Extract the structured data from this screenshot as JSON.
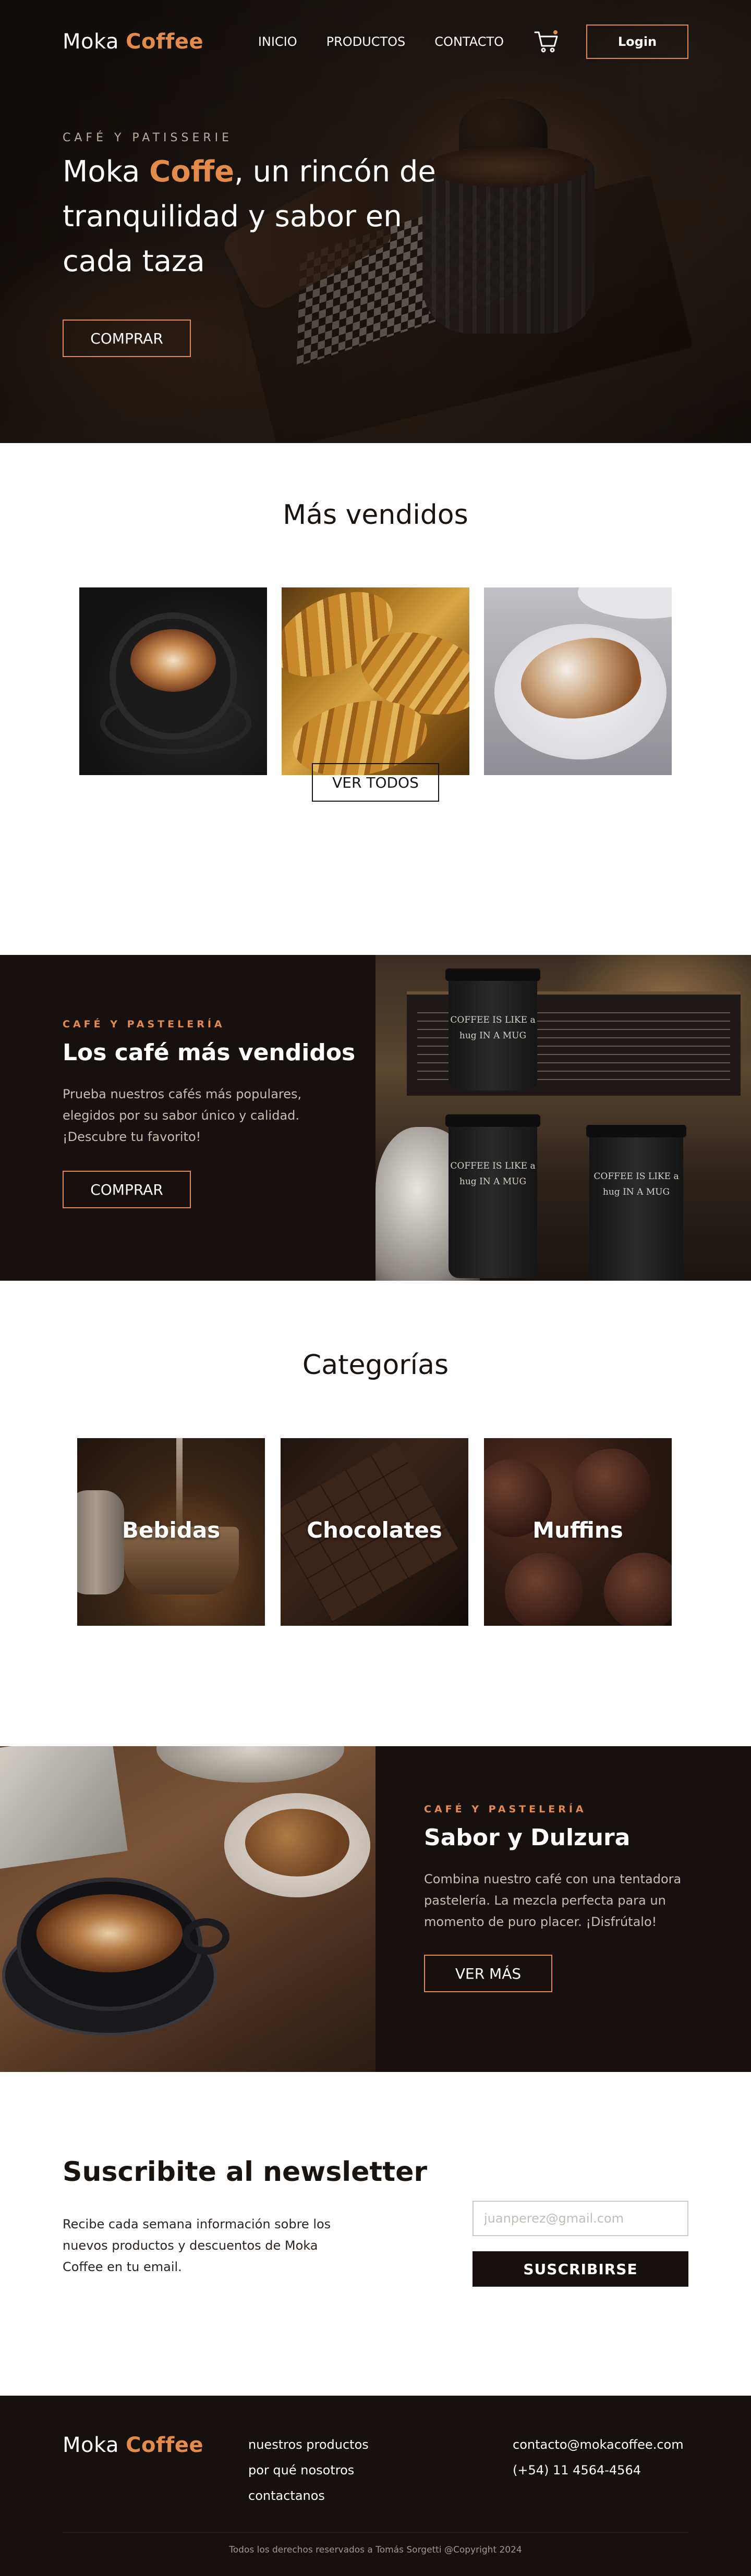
{
  "header": {
    "logo": {
      "part1": "Moka ",
      "part2": "Coffee"
    },
    "nav": [
      "INICIO",
      "PRODUCTOS",
      "CONTACTO"
    ],
    "cart_icon": "cart-icon",
    "login_label": "Login"
  },
  "hero": {
    "eyebrow": "CAFÉ Y PATISSERIE",
    "title_part1": "Moka ",
    "title_accent": "Coffe",
    "title_part2": ", un rincón de tranquilidad y sabor en cada taza",
    "cta_label": "COMPRAR"
  },
  "bestsellers": {
    "title": "Más vendidos",
    "see_all_label": "VER TODOS"
  },
  "promo_coffee": {
    "eyebrow": "CAFÉ Y PASTELERÍA",
    "title": "Los café más vendidos",
    "description": "Prueba nuestros cafés más populares, elegidos por su sabor único y calidad. ¡Descubre tu favorito!",
    "cta_label": "COMPRAR",
    "cup_text": "COFFEE IS LIKE a hug IN A MUG"
  },
  "categories": {
    "title": "Categorías",
    "items": [
      "Bebidas",
      "Chocolates",
      "Muffins"
    ]
  },
  "promo_sweet": {
    "eyebrow": "CAFÉ Y PASTELERÍA",
    "title": "Sabor y Dulzura",
    "description": "Combina nuestro café con una tentadora pastelería. La mezcla perfecta para un momento de puro placer. ¡Disfrútalo!",
    "cta_label": "VER MÁS"
  },
  "newsletter": {
    "title": "Suscribite al newsletter",
    "description": "Recibe cada semana información sobre los nuevos productos y descuentos de Moka Coffee en tu email.",
    "email_placeholder": "juanperez@gmail.com",
    "subscribe_label": "SUSCRIBIRSE"
  },
  "footer": {
    "logo": {
      "part1": "Moka ",
      "part2": "Coffee"
    },
    "links": [
      "nuestros productos",
      "por qué nosotros",
      "contactanos"
    ],
    "email": "contacto@mokacoffee.com",
    "phone": "(+54) 11 4564-4564",
    "copyright": "Todos los derechos reservados a Tomás Sorgetti @Copyright 2024"
  },
  "colors": {
    "accent": "#e58b4a",
    "dark": "#16110e"
  }
}
